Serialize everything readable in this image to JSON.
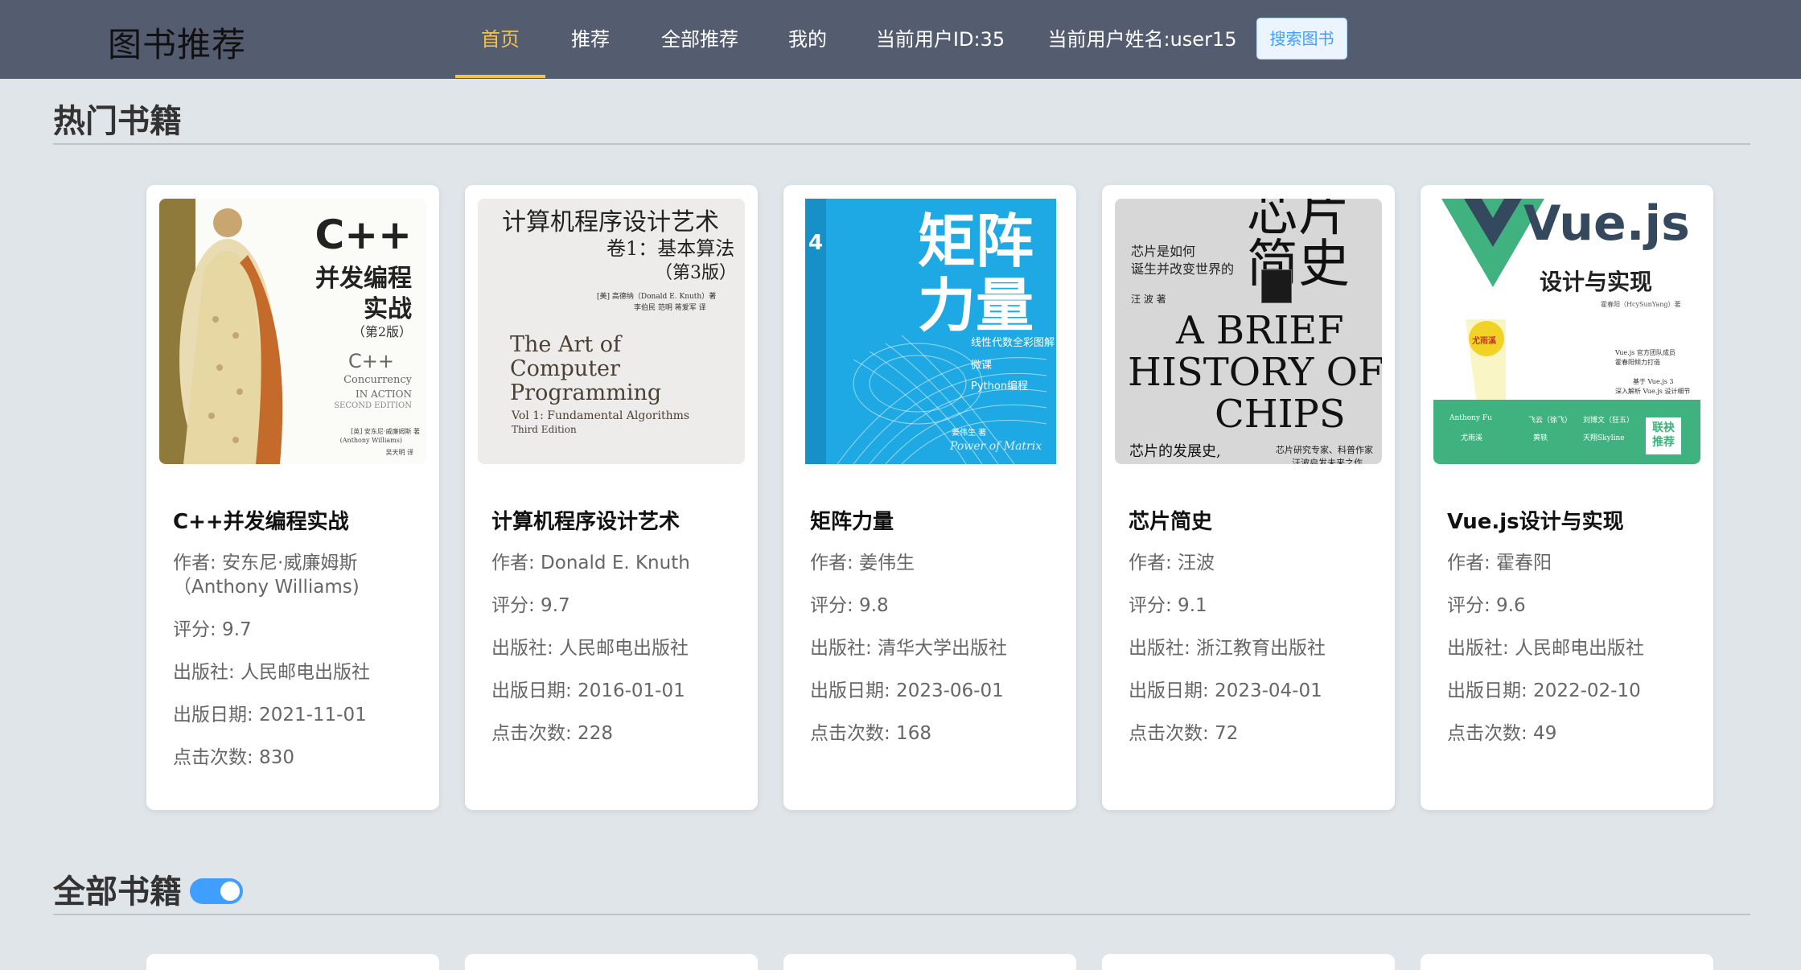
{
  "header": {
    "brand": "图书推荐",
    "nav": [
      "首页",
      "推荐",
      "全部推荐",
      "我的",
      "当前用户ID:35",
      "当前用户姓名:user15"
    ],
    "search_button": "搜索图书",
    "active_color": "#f0c350",
    "bg_color": "#545c70"
  },
  "hot_section": {
    "title": "热门书籍"
  },
  "all_section": {
    "title": "全部书籍",
    "toggle_on": true
  },
  "books": [
    {
      "title": "C++并发编程实战",
      "author": "作者: 安东尼·威廉姆斯（Anthony Williams)",
      "rating": "评分: 9.7",
      "publisher": "出版社: 人民邮电出版社",
      "date": "出版日期: 2021-11-01",
      "clicks": "点击次数: 830",
      "cover": {
        "line1": "C++",
        "line2": "并发编程",
        "line3": "实战",
        "line4": "（第2版）",
        "line5": "C++",
        "line6": "Concurrency",
        "line7": "IN ACTION",
        "line8": "SECOND EDITION",
        "line9": "[英] 安东尼·威廉姆斯 著",
        "line10": "(Anthony Williams)",
        "line11": "吴天明 译"
      }
    },
    {
      "title": "计算机程序设计艺术",
      "author": "作者: Donald E. Knuth",
      "rating": "评分: 9.7",
      "publisher": "出版社: 人民邮电出版社",
      "date": "出版日期: 2016-01-01",
      "clicks": "点击次数: 228",
      "cover": {
        "line1": "计算机程序设计艺术",
        "line2": "卷1：基本算法",
        "line3": "（第3版）",
        "line4": "[美] 高德纳（Donald E. Knuth）著",
        "line5": "李伯民 范明 蒋爱军 译",
        "line6": "The Art of",
        "line7": "Computer",
        "line8": "Programming",
        "line9": "Vol 1: Fundamental Algorithms",
        "line10": "Third Edition"
      }
    },
    {
      "title": "矩阵力量",
      "author": "作者: 姜伟生",
      "rating": "评分: 9.8",
      "publisher": "出版社: 清华大学出版社",
      "date": "出版日期: 2023-06-01",
      "clicks": "点击次数: 168",
      "cover": {
        "line1": "矩阵",
        "line2": "力量",
        "line3": "4",
        "line4": "线性代数全彩图解",
        "line5": "微课",
        "line6": "Python编程",
        "line7": "姜伟生 著",
        "line8": "Power of Matrix"
      }
    },
    {
      "title": "芯片简史",
      "author": "作者: 汪波",
      "rating": "评分: 9.1",
      "publisher": "出版社: 浙江教育出版社",
      "date": "出版日期: 2023-04-01",
      "clicks": "点击次数: 72",
      "cover": {
        "line1": "芯片",
        "line2": "简史",
        "line3": "芯片是如何",
        "line4": "诞生并改变世界的",
        "line5": "汪 波 著",
        "line6": "A BRIEF",
        "line7": "HISTORY OF",
        "line8": "CHIPS",
        "line9": "芯片的发展史,",
        "line10": "芯片研究专家、科普作家",
        "line11": "汪波启发未来之作"
      }
    },
    {
      "title": "Vue.js设计与实现",
      "author": "作者: 霍春阳",
      "rating": "评分: 9.6",
      "publisher": "出版社: 人民邮电出版社",
      "date": "出版日期: 2022-02-10",
      "clicks": "点击次数: 49",
      "cover": {
        "line1": "Vue.js",
        "line2": "设计与实现",
        "line3": "霍春阳（HcySunYang）著",
        "line4": "尤雨溪",
        "line5": "Vue.js 官方团队成员",
        "line6": "霍春阳倾力打造",
        "line7": "基于 Vue.js 3",
        "line8": "深入解析 Vue.js 设计细节",
        "line9": "Anthony Fu",
        "line10": "飞云（徐飞）",
        "line11": "刘博文（狂五）",
        "line12": "尤雨溪",
        "line13": "黄轶",
        "line14": "天翔Skyline",
        "line15": "联袂推荐"
      }
    }
  ]
}
